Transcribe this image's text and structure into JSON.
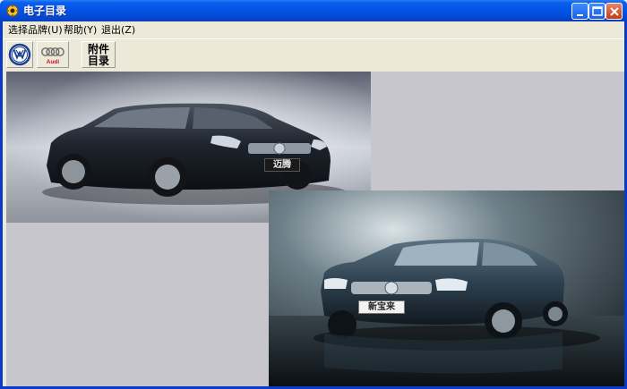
{
  "window": {
    "title": "电子目录"
  },
  "menu": [
    {
      "label": "选择品牌(U)"
    },
    {
      "label": "帮助(Y)"
    },
    {
      "label": "退出(Z)"
    }
  ],
  "toolbar": {
    "vw_icon": "vw-logo-icon",
    "audi_icon": "audi-logo-icon",
    "audi_text": "Audi",
    "attachment_label": "附件\n目录"
  },
  "cars": [
    {
      "name": "Magotan",
      "plate": "迈腾"
    },
    {
      "name": "New Bora",
      "plate": "新宝来"
    }
  ],
  "colors": {
    "title_bar": "#0355e6",
    "content_bg": "#c7c6cc",
    "car_body": "#2c3540"
  }
}
